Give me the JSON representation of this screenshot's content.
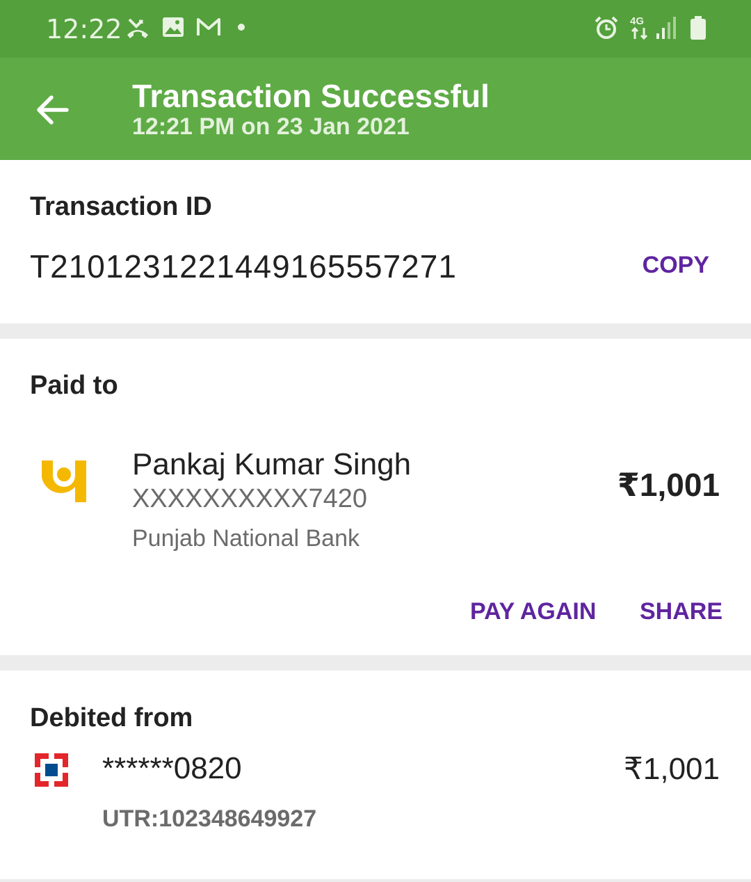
{
  "status_bar": {
    "time": "12:22",
    "network_label": "4G",
    "icons": [
      "missed-call-icon",
      "gallery-icon",
      "gmail-icon",
      "notification-dot-icon",
      "alarm-icon",
      "network-4g-icon",
      "signal-icon",
      "battery-icon"
    ]
  },
  "header": {
    "title": "Transaction Successful",
    "subtitle": "12:21 PM on 23 Jan 2021",
    "back_icon": "back-arrow-icon"
  },
  "transaction": {
    "label": "Transaction ID",
    "id": "T2101231221449165557271",
    "copy_label": "COPY"
  },
  "paid_to": {
    "label": "Paid to",
    "name": "Pankaj Kumar Singh",
    "account": "XXXXXXXXXX7420",
    "bank": "Punjab National Bank",
    "amount": "₹1,001",
    "bank_icon": "pnb-logo-icon",
    "pay_again_label": "PAY AGAIN",
    "share_label": "SHARE"
  },
  "debited_from": {
    "label": "Debited from",
    "account": "******0820",
    "amount": "₹1,001",
    "utr": "UTR:102348649927",
    "bank_icon": "hdfc-logo-icon"
  },
  "colors": {
    "status_bar": "#54a03c",
    "app_bar": "#5fab46",
    "accent": "#5f259f",
    "pnb_yellow": "#f5b800",
    "hdfc_red": "#e3262b",
    "hdfc_blue": "#004c8f"
  }
}
